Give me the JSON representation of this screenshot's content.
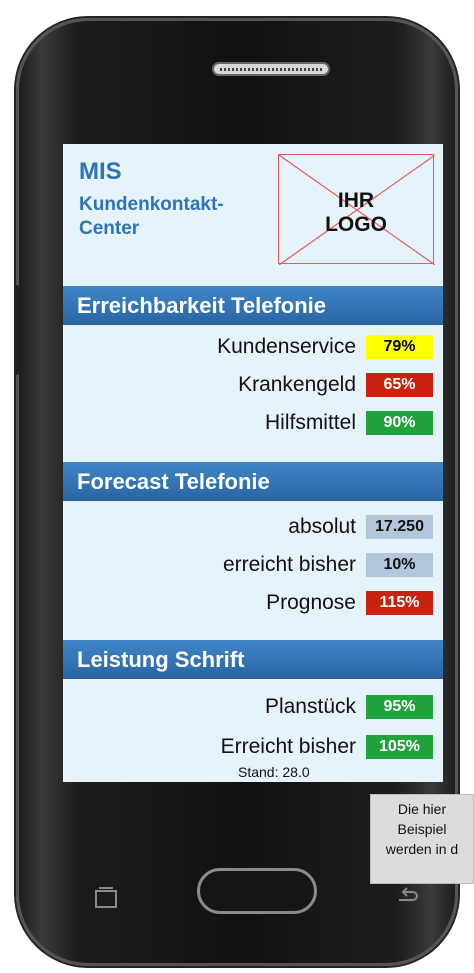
{
  "header": {
    "title": "MIS",
    "subtitle": "Kundenkontakt-Center",
    "logo_text_line1": "IHR",
    "logo_text_line2": "LOGO"
  },
  "sections": [
    {
      "title": "Erreichbarkeit Telefonie",
      "rows": [
        {
          "label": "Kundenservice",
          "value": "79%",
          "color": "#ffff00"
        },
        {
          "label": "Krankengeld",
          "value": "65%",
          "color": "#c9230f"
        },
        {
          "label": "Hilfsmittel",
          "value": "90%",
          "color": "#1fa33a"
        }
      ]
    },
    {
      "title": "Forecast Telefonie",
      "rows": [
        {
          "label": "absolut",
          "value": "17.250",
          "color": "#b4c6dc"
        },
        {
          "label": "erreicht bisher",
          "value": "10%",
          "color": "#b4c6dc"
        },
        {
          "label": "Prognose",
          "value": "115%",
          "color": "#c9230f"
        }
      ]
    },
    {
      "title": "Leistung Schrift",
      "rows": [
        {
          "label": "Planstück",
          "value": "95%",
          "color": "#1fa33a"
        },
        {
          "label": "Erreicht bisher",
          "value": "105%",
          "color": "#1fa33a"
        }
      ]
    }
  ],
  "footer": {
    "stand": "Stand: 28.0"
  },
  "note": {
    "line1": "Die hier",
    "line2": "Beispiel",
    "line3": "werden in d"
  },
  "icons": [
    "speaker-grille-icon",
    "recent-apps-icon",
    "home-button",
    "back-icon"
  ]
}
